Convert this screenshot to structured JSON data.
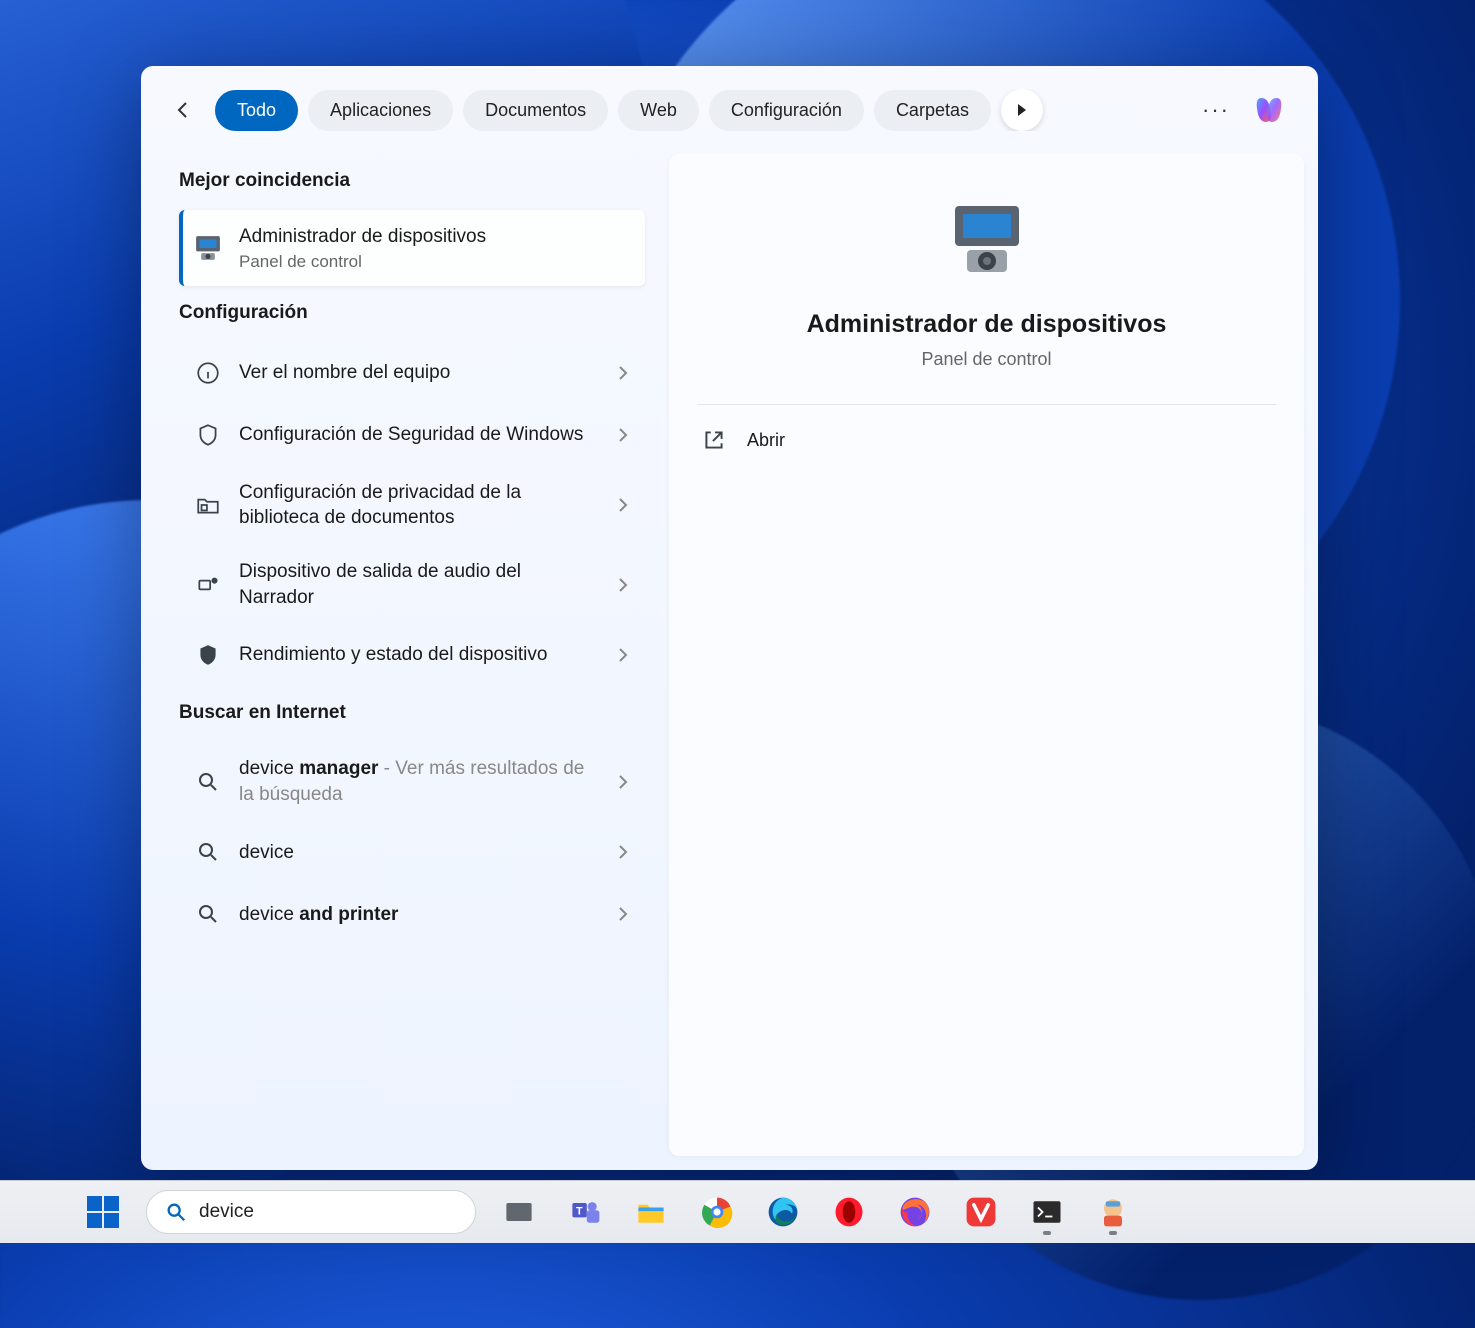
{
  "filters": {
    "all": "Todo",
    "apps": "Aplicaciones",
    "docs": "Documentos",
    "web": "Web",
    "settings": "Configuración",
    "folders": "Carpetas"
  },
  "sections": {
    "best_match": "Mejor coincidencia",
    "settings": "Configuración",
    "search_web": "Buscar en Internet"
  },
  "best_match": {
    "title": "Administrador de dispositivos",
    "subtitle": "Panel de control"
  },
  "settings_results": [
    {
      "label": "Ver el nombre del equipo"
    },
    {
      "label": "Configuración de Seguridad de Windows"
    },
    {
      "label": "Configuración de privacidad de la biblioteca de documentos"
    },
    {
      "label": "Dispositivo de salida de audio del Narrador"
    },
    {
      "label": "Rendimiento y estado del dispositivo"
    }
  ],
  "web_results": {
    "r0_prefix": "device ",
    "r0_bold": "manager",
    "r0_suffix": " - Ver más resultados de la búsqueda",
    "r1": "device",
    "r2_prefix": "device ",
    "r2_bold": "and printer"
  },
  "preview": {
    "title": "Administrador de dispositivos",
    "subtitle": "Panel de control",
    "open": "Abrir"
  },
  "taskbar": {
    "search_value": "device"
  }
}
